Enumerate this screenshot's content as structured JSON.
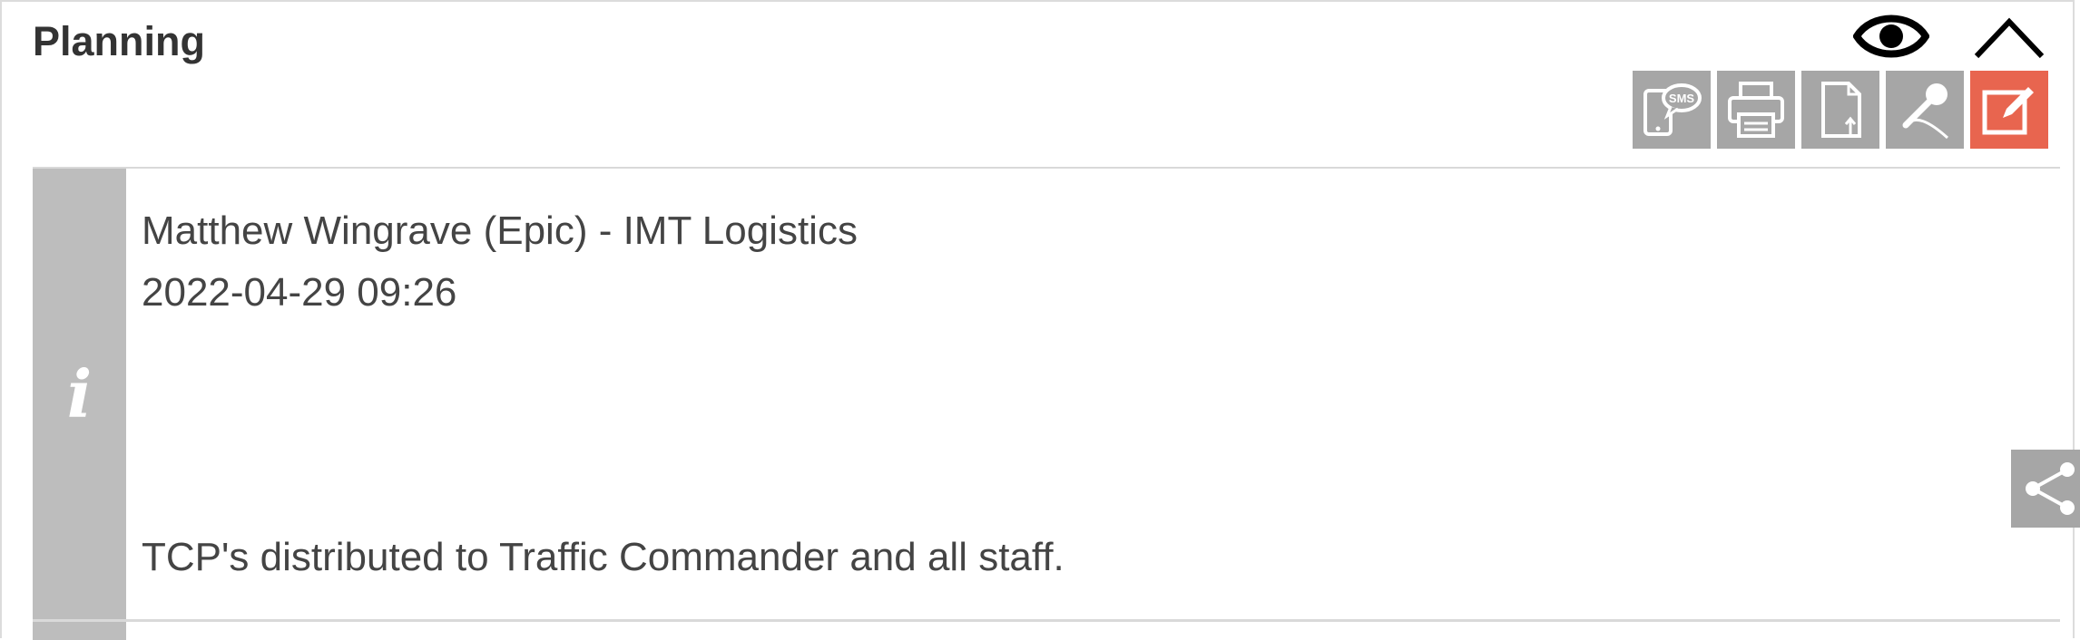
{
  "panel": {
    "title": "Planning"
  },
  "header_icons": [
    "eye-icon",
    "chevron-up-icon"
  ],
  "toolbar": {
    "buttons": [
      {
        "name": "sms-button",
        "icon": "sms-phone-icon",
        "label": "SMS"
      },
      {
        "name": "print-button",
        "icon": "printer-icon"
      },
      {
        "name": "export-button",
        "icon": "document-upload-icon"
      },
      {
        "name": "dictate-button",
        "icon": "microphone-icon"
      },
      {
        "name": "edit-button",
        "icon": "edit-icon",
        "active": true
      }
    ]
  },
  "colors": {
    "accent": "#e8654f",
    "icon_bg": "#a6a6a6",
    "info_bar": "#bdbdbd"
  },
  "entry": {
    "author": "Matthew Wingrave (Epic) - IMT Logistics",
    "timestamp": "2022-04-29 09:26",
    "message": "TCP's distributed to Traffic Commander and all staff.",
    "info_icon": "i"
  }
}
